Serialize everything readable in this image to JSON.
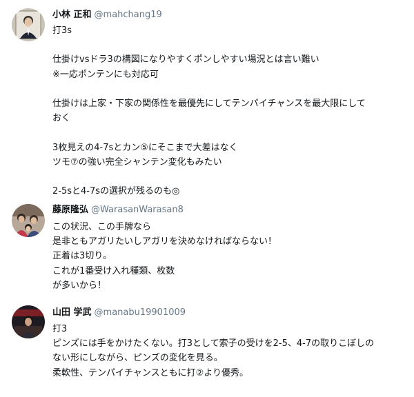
{
  "tweets": [
    {
      "name": "小林 正和",
      "handle": "@mahchang19",
      "lines": [
        "打3s",
        "",
        "仕掛けvsドラ3の構図になりやすくポンしやすい場況とは言い難い",
        "※一応ポンテンにも対応可",
        "",
        "仕掛けは上家・下家の関係性を最優先にしてテンパイチャンスを最大限にして",
        "おく",
        "",
        "3枚見えの4-7sとカン⑤にそこまで大差はなく",
        "ツモ⑦の強い完全シャンテン変化もみたい",
        "",
        "2-5sと4-7sの選択が残るのも◎"
      ]
    },
    {
      "name": "藤原隆弘",
      "handle": "@WarasanWarasan8",
      "lines": [
        "この状況、この手牌なら",
        "是非ともアガリたいしアガリを決めなければならない！",
        "正着は3切り。",
        "これが1番受け入れ種類、枚数",
        "が多いから！"
      ]
    },
    {
      "name": "山田 学武",
      "handle": "@manabu19901009",
      "lines": [
        "打3",
        "ピンズには手をかけたくない。打3として索子の受けを2-5、4-7の取りこぼしの",
        "ない形にしながら、ピンズの変化を見る。",
        "柔軟性、テンパイチャンスともに打②より優秀。"
      ]
    }
  ],
  "colors": {
    "name": "#14171a",
    "handle": "#657786",
    "text": "#14171a",
    "background": "#ffffff"
  }
}
